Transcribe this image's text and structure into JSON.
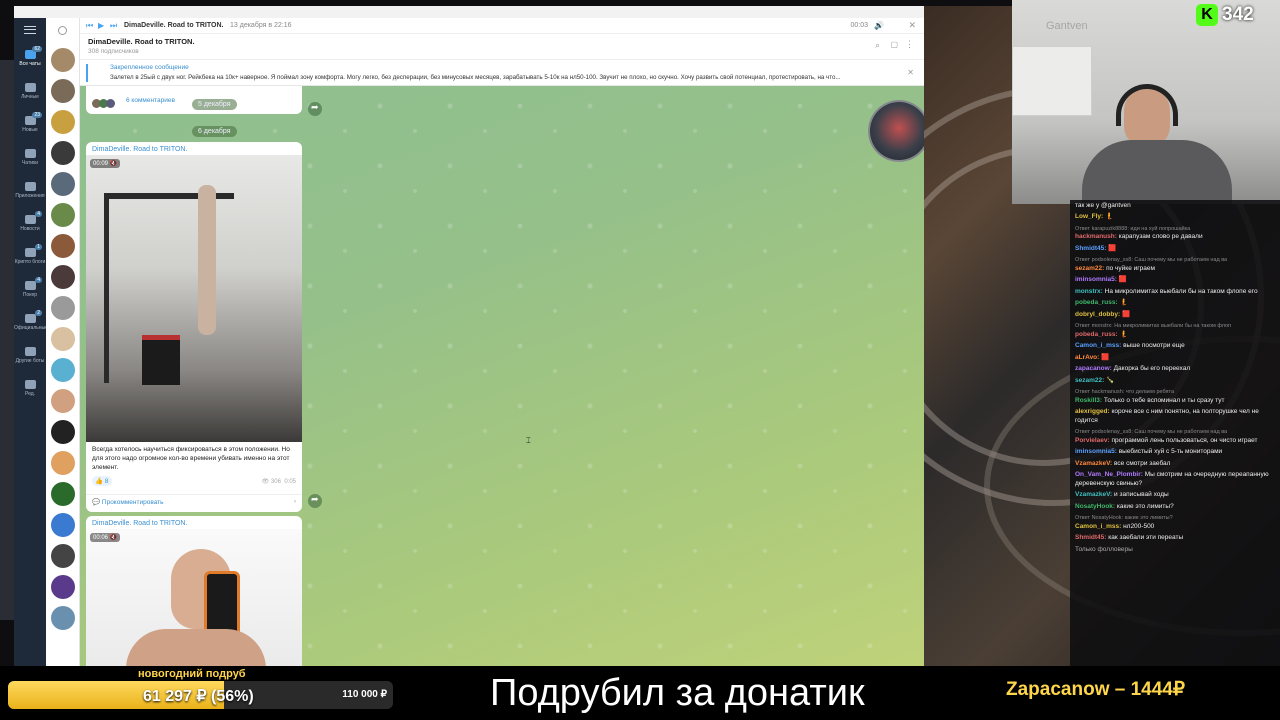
{
  "telegram": {
    "player": {
      "title": "DimaDeville. Road to TRITON.",
      "date": "13 декабря в 22:16",
      "time": "00:03"
    },
    "channel": {
      "name": "DimaDeville. Road to TRITON.",
      "subscribers": "308 подписчиков"
    },
    "pinned": {
      "label": "Закрепленное сообщение",
      "text": "Залетел в 25ый с двух ног. Рейкбека на 10к+ наверное.  Я поймал зону комфорта. Могу легко, без десперации, без минусовых месяцев, зарабатывать 5-10к на нл50-100. Звучит не плохо, но скучно. Хочу развить свой потенциал, протестировать, на что..."
    },
    "rail": [
      {
        "label": "Все чаты",
        "badge": "62",
        "icon": "chat-bubble-icon"
      },
      {
        "label": "Личные",
        "badge": "",
        "icon": "person-icon"
      },
      {
        "label": "Новые",
        "badge": "23",
        "icon": "new-icon"
      },
      {
        "label": "Чатики",
        "badge": "",
        "icon": "folder-icon"
      },
      {
        "label": "Приложения",
        "badge": "",
        "icon": "folder-icon"
      },
      {
        "label": "Новости",
        "badge": "4",
        "icon": "folder-icon"
      },
      {
        "label": "Крипто блоги",
        "badge": "1",
        "icon": "folder-icon"
      },
      {
        "label": "Покер",
        "badge": "4",
        "icon": "folder-icon"
      },
      {
        "label": "Официальные",
        "badge": "2",
        "icon": "folder-icon"
      },
      {
        "label": "Другие боты",
        "badge": "",
        "icon": "folder-icon"
      },
      {
        "label": "Ред.",
        "badge": "",
        "icon": "edit-icon"
      }
    ],
    "messages": [
      {
        "comments": "6 комментариев",
        "date_after": "5 декабря"
      },
      {
        "date_before": "6 декабря",
        "author": "DimaDeville. Road to TRITON.",
        "video_time": "00:09",
        "caption": "Всегда хотелось научиться фиксироваться в этом положении. Но для этого надо огромное кол-во времени убивать именно на этот элемент.",
        "reaction": "👍 8",
        "views": "306",
        "time": "0:05",
        "comment_cta": "Прокомментировать"
      },
      {
        "author": "DimaDeville. Road to TRITON.",
        "video_time": "00:06"
      }
    ]
  },
  "stream": {
    "viewers": "342",
    "chat": [
      {
        "user": "",
        "text": "так же у @gantven"
      },
      {
        "user": "Low_Fly:",
        "text": "🧜"
      },
      {
        "reply": "Ответ karapuzik8888: иди на хуй попрошайка",
        "user": "hackmanush:",
        "text": "карапузам слово ре давали"
      },
      {
        "user": "Shmidt45:",
        "text": "🟥"
      },
      {
        "reply": "Ответ podsolenay_ss8: Саш почему мы не работаем над ва",
        "user": "sezam22:",
        "text": "по чуйке играем"
      },
      {
        "user": "iminsomnia5:",
        "text": "🟥"
      },
      {
        "user": "monstrx:",
        "text": "На микролимитах выебали бы на таком флопе его"
      },
      {
        "user": "pobeda_russ:",
        "text": "🧜"
      },
      {
        "user": "dobryl_dobby:",
        "text": "🟥"
      },
      {
        "reply": "Ответ monstrx: На микролимитах выебали бы на таком флоп",
        "user": "pobeda_russ:",
        "text": "🧜"
      },
      {
        "user": "Camon_i_mss:",
        "text": "выше посмотри еще"
      },
      {
        "user": "aLrAvo:",
        "text": "🟥"
      },
      {
        "user": "zapacanow:",
        "text": "Дакорка бы его переехал"
      },
      {
        "user": "sezam22:",
        "text": "🍾"
      },
      {
        "reply": "Ответ hackmanush: что делаем ребята",
        "user": "Roskill3:",
        "text": "Только о тебе вспоминал и ты сразу тут"
      },
      {
        "user": "alexrigged:",
        "text": "короче все с ним понятно, на полторушке чел не годится"
      },
      {
        "reply": "Ответ podsolenay_ss8: Саш почему мы не работаем над ва",
        "user": "Porvielaev:",
        "text": "программой лень пользоваться, он чисто играет"
      },
      {
        "user": "iminsomnia5:",
        "text": "выебистый хуй с 5-ть мониторами"
      },
      {
        "user": "VzamazkeV:",
        "text": "все смотри заебал"
      },
      {
        "user": "On_Vam_Ne_Plombir:",
        "text": "Мы смотрим на очередную переапанную деревенскую свинью?"
      },
      {
        "user": "VzamazkeV:",
        "text": "и записывай ходы"
      },
      {
        "user": "NosatyHook:",
        "text": "какие это лимиты?"
      },
      {
        "reply": "Ответ NosatyHook: какие это лимиты?",
        "user": "Camon_i_mss:",
        "text": "нл200-500"
      },
      {
        "user": "Shmidt45:",
        "text": "как заебали эти переаты"
      }
    ],
    "chat_footer": "Только фолловеры"
  },
  "goal": {
    "title": "новогодний подруб",
    "current": "61 297 ₽ (56%)",
    "target": "110 000 ₽",
    "progress": 0.56
  },
  "donation": {
    "message": "Подрубил за донатик",
    "donor": "Zapacanow – 1444₽"
  },
  "colors": {
    "kick_green": "#53fc18",
    "goal_yellow": "#ffd54a",
    "telegram_blue": "#3a8fd0"
  }
}
